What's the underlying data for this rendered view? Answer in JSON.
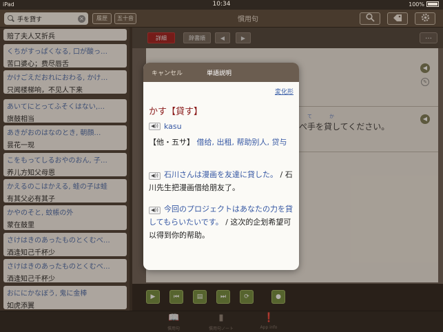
{
  "status": {
    "device": "iPad",
    "time": "10:34",
    "battery": "100%"
  },
  "nav": {
    "search_value": "手を貸す",
    "search_placeholder": "",
    "history_label": "履歴",
    "gojuon_label": "五十音",
    "title": "慣用句",
    "search_icon": "search-icon",
    "tag_icon": "tag-icon",
    "settings_icon": "gear-icon"
  },
  "list": [
    {
      "jp": "",
      "cn": "赔了夫人又折兵"
    },
    {
      "jp": "くちがすっぱくなる, 口が酸っ…",
      "cn": "苦口婆心；费尽唇舌"
    },
    {
      "jp": "かけごえだおれにおわる, かけ…",
      "cn": "只闻楼梯响，不见人下来"
    },
    {
      "jp": "あいてにとってふそくはない,…",
      "cn": "旗鼓相当"
    },
    {
      "jp": "あきがおのはなのとき, 朝顔…",
      "cn": "昙花一现"
    },
    {
      "jp": "こをもってしるおやのおん, 子…",
      "cn": "养儿方知父母恩"
    },
    {
      "jp": "かえるのこはかえる, 蛙の子は蛙",
      "cn": "有其父必有其子"
    },
    {
      "jp": "かやのそと, 蚊帳の外",
      "cn": "蒙在鼓里"
    },
    {
      "jp": "さけはきのあったものとくむべ…",
      "cn": "酒逢知己千杯少"
    },
    {
      "jp": "さけはきのあったものとくむべ…",
      "cn": "酒逢知己千杯少"
    },
    {
      "jp": "おににかなぼう, 鬼に金棒",
      "cn": "如虎添翼"
    }
  ],
  "detail": {
    "tab_detail": "詳細",
    "tab_dictionary": "辞書順",
    "prev_label": "◀",
    "next_label": "▶",
    "more_label": "…",
    "sentence_ruby": [
      "て",
      "か"
    ],
    "sentence_visible": "ぺ手を貸してください。"
  },
  "popover": {
    "cancel": "キャンセル",
    "title": "単語説明",
    "inflection": "変化形",
    "headword": "かす【貸す】",
    "kana": "kasu",
    "pos": "【他・五サ】",
    "meaning": "借给, 出租, 帮助别人, 贷与",
    "ex1_jp": "石川さんは漫画を友達に貸した。",
    "ex1_cn": "/ 石川先生把漫画借给朋友了。",
    "ex2_jp": "今回のプロジェクトはあなたの力を貸してもらいたいです。",
    "ex2_cn": " / 这次的企划希望可以得到你的帮助。",
    "sound_label": "◀))"
  },
  "tabbar": {
    "tab1": "慣用句",
    "tab2": "慣用句ノート",
    "tab3": "App info"
  },
  "colors": {
    "accent_red": "#9e1c1c",
    "link_blue": "#3557a3",
    "headword": "#8a1a1a",
    "control_green": "#6f8a3c"
  }
}
